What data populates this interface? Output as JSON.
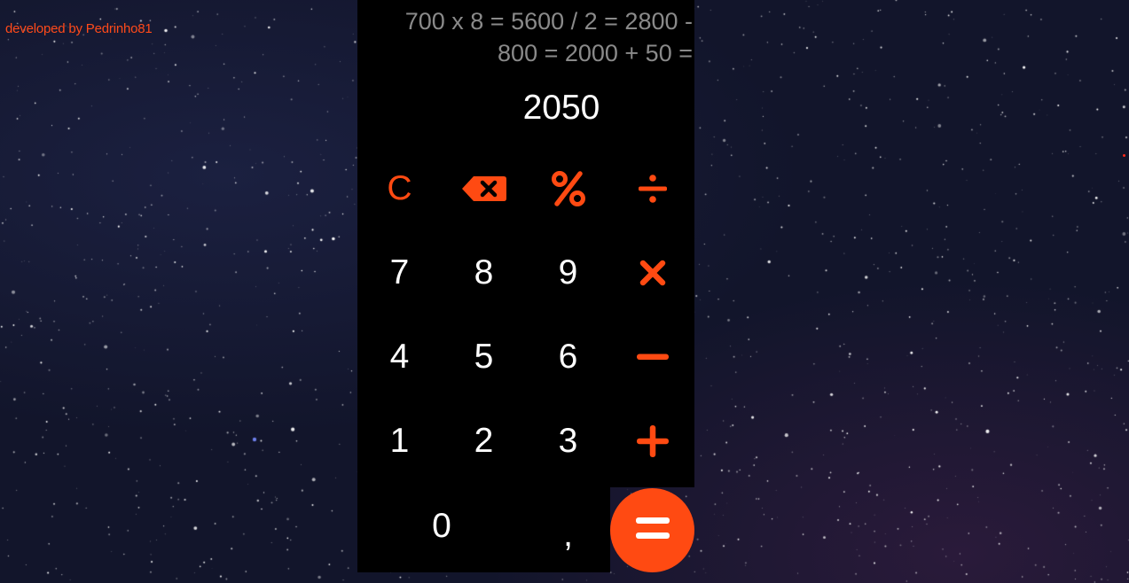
{
  "credit": "developed by Pedrinho81",
  "display": {
    "history": "700 x 8 = 5600 / 2 = 2800 - 800 = 2000 + 50 =",
    "result": "2050"
  },
  "keys": {
    "clear": "C",
    "backspace_icon": "backspace-icon",
    "percent_icon": "percent-icon",
    "divide_icon": "divide-icon",
    "seven": "7",
    "eight": "8",
    "nine": "9",
    "multiply_icon": "multiply-icon",
    "four": "4",
    "five": "5",
    "six": "6",
    "minus_icon": "minus-icon",
    "one": "1",
    "two": "2",
    "three": "3",
    "plus_icon": "plus-icon",
    "zero": "0",
    "comma": ",",
    "equals_icon": "equals-icon"
  },
  "colors": {
    "accent": "#ff4a12",
    "panel": "#000000",
    "history_text": "#8a8a8a",
    "digit_text": "#ffffff",
    "background": "#12152b"
  }
}
